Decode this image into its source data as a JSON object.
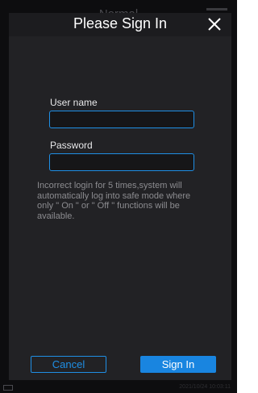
{
  "background": {
    "title": "Normal",
    "footer_text": "2021/10/24 10:03:11"
  },
  "dialog": {
    "title": "Please Sign In",
    "close_icon": "close-icon",
    "username": {
      "label": "User name",
      "value": "",
      "placeholder": ""
    },
    "password": {
      "label": "Password",
      "value": "",
      "placeholder": ""
    },
    "notice": "Incorrect login for 5 times,system will automatically log into safe mode where only \" On \" or \" Off \" functions will be available.",
    "cancel_label": "Cancel",
    "signin_label": "Sign In"
  },
  "colors": {
    "accent": "#1f8fe5",
    "dialog_bg": "#222225",
    "screen_bg": "#0d0d0f",
    "notice_text": "#8c8c90"
  }
}
